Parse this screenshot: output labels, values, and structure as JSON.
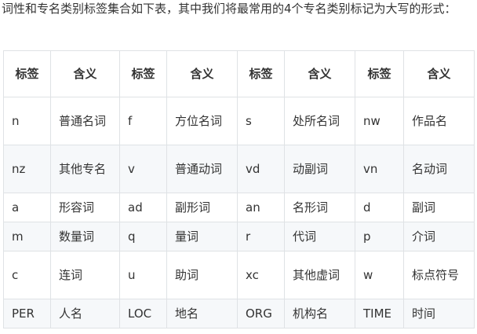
{
  "intro_text": "词性和专名类别标签集合如下表，其中我们将最常用的4个专名类别标记为大写的形式：",
  "table": {
    "headers": [
      "标签",
      "含义",
      "标签",
      "含义",
      "标签",
      "含义",
      "标签",
      "含义"
    ],
    "rows": [
      [
        "n",
        "普通名词",
        "f",
        "方位名词",
        "s",
        "处所名词",
        "nw",
        "作品名"
      ],
      [
        "nz",
        "其他专名",
        "v",
        "普通动词",
        "vd",
        "动副词",
        "vn",
        "名动词"
      ],
      [
        "a",
        "形容词",
        "ad",
        "副形词",
        "an",
        "名形词",
        "d",
        "副词"
      ],
      [
        "m",
        "数量词",
        "q",
        "量词",
        "r",
        "代词",
        "p",
        "介词"
      ],
      [
        "c",
        "连词",
        "u",
        "助词",
        "xc",
        "其他虚词",
        "w",
        "标点符号"
      ],
      [
        "PER",
        "人名",
        "LOC",
        "地名",
        "ORG",
        "机构名",
        "TIME",
        "时间"
      ]
    ]
  }
}
